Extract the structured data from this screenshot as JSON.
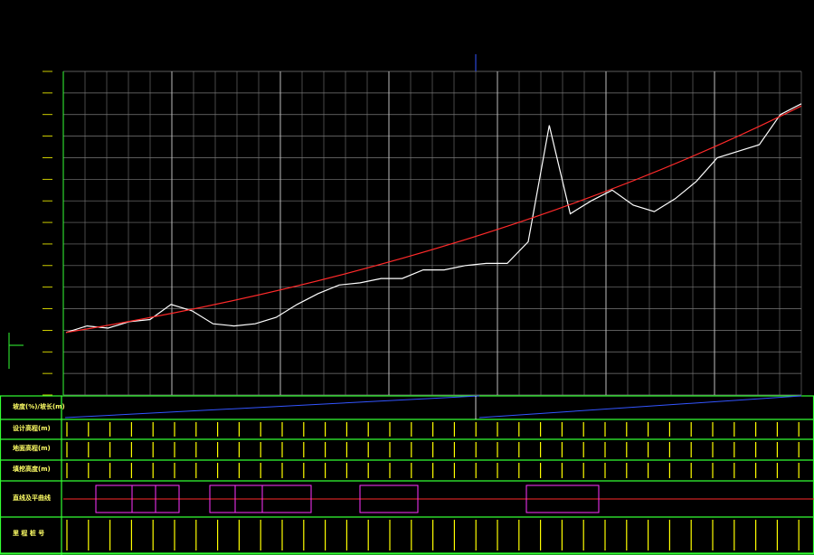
{
  "chart_data": {
    "type": "line",
    "ylim": [
      0,
      15
    ],
    "yticks": [
      "",
      "",
      "",
      "",
      "",
      "",
      "",
      "",
      "",
      "",
      "",
      "",
      "",
      "",
      "",
      ""
    ],
    "ground_x": [
      0,
      1,
      2,
      3,
      4,
      5,
      6,
      7,
      8,
      9,
      10,
      11,
      12,
      13,
      14,
      15,
      16,
      17,
      18,
      19,
      20,
      21,
      22,
      23,
      24,
      25,
      26,
      27,
      28,
      29,
      30,
      31,
      32,
      33,
      34,
      35
    ],
    "ground_y": [
      2.9,
      3.2,
      3.1,
      3.4,
      3.5,
      4.2,
      3.9,
      3.3,
      3.2,
      3.3,
      3.6,
      4.2,
      4.7,
      5.1,
      5.2,
      5.4,
      5.4,
      5.8,
      5.8,
      6.0,
      6.1,
      6.1,
      7.1,
      12.5,
      8.4,
      9.0,
      9.5,
      8.8,
      8.5,
      9.1,
      9.9,
      11.0,
      11.3,
      11.6,
      13.0,
      13.5
    ],
    "design_x": [
      0,
      35
    ],
    "design_y": [
      2.9,
      13.4
    ],
    "series": [
      {
        "name": "",
        "color": "#ffffff"
      },
      {
        "name": "",
        "color": "#ff2a2a"
      }
    ],
    "grid": true
  },
  "colors": {
    "grid": "#7a7a7a",
    "frame": "#33ff33",
    "design_line": "#ff2a2a",
    "ground_line": "#ffffff",
    "slope_line": "#3355ff",
    "row_label": "#ffff66",
    "curve_box": "#ff33ff"
  },
  "rows": [
    {
      "label": "坡度(%)/坡长(m)"
    },
    {
      "label": "设计高程(m)"
    },
    {
      "label": "地面高程(m)"
    },
    {
      "label": "填挖高度(m)"
    },
    {
      "label": "直线及平曲线"
    },
    {
      "label": "里 程 桩 号"
    }
  ]
}
